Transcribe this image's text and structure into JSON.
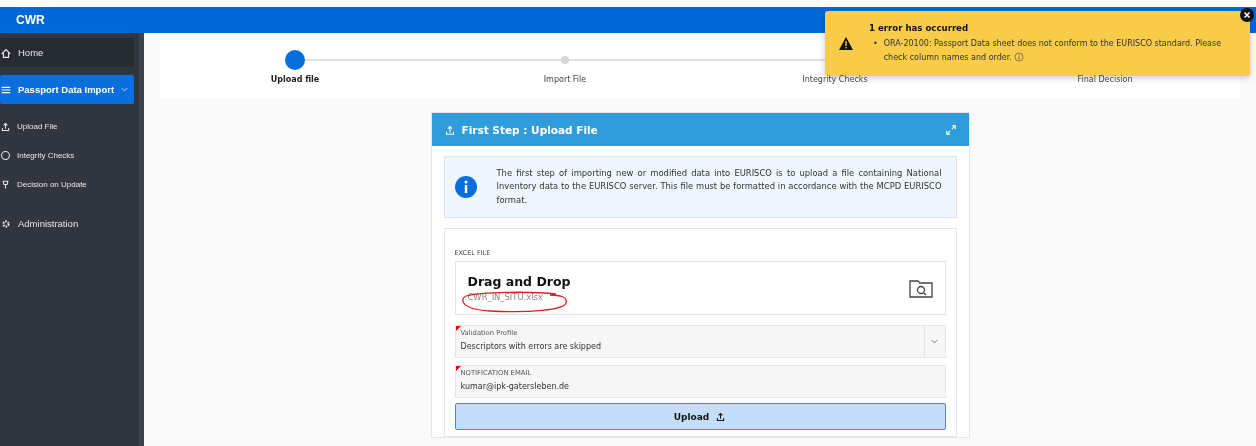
{
  "header": {
    "title": "CWR"
  },
  "sidebar": {
    "items": [
      {
        "label": "Home",
        "selected": false,
        "highlighted": true
      },
      {
        "label": "Passport Data Import",
        "selected": true,
        "highlighted": false,
        "expanded": true,
        "children": [
          {
            "label": "Upload File"
          },
          {
            "label": "Integrity Checks"
          },
          {
            "label": "Decision on Update"
          }
        ]
      },
      {
        "label": "Administration",
        "selected": false,
        "highlighted": false
      }
    ]
  },
  "steps": [
    {
      "label": "Upload file",
      "selected": true
    },
    {
      "label": "Import File",
      "selected": false
    },
    {
      "label": "Integrity Checks",
      "selected": false
    },
    {
      "label": "Final Decision",
      "selected": false
    }
  ],
  "panel": {
    "title": "First Step : Upload File",
    "info": "The first step of importing new or modified data into EURISCO is to upload a file containing National Inventory data to the EURISCO server. This file must be formatted in accordance with the MCPD EURISCO format.",
    "file_label": "EXCEL FILE",
    "drop_title": "Drag and Drop",
    "file_name": "CWR_IN_SITU.xlsx",
    "profile": {
      "label": "Validation Profile",
      "value": "Descriptors with errors are skipped"
    },
    "email": {
      "label": "NOTIFICATION EMAIL",
      "value": "kumar@ipk-gatersleben.de"
    },
    "upload_button": "Upload"
  },
  "toast": {
    "title": "1 error has occurred",
    "bullet": "•",
    "messages": [
      "ORA-20100: Passport Data sheet does not conform to the EURISCO standard. Please check column names and order."
    ]
  }
}
